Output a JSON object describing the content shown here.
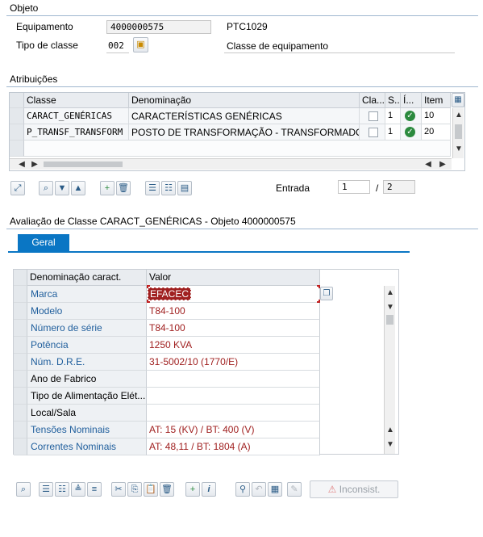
{
  "objeto": {
    "title": "Objeto",
    "equipamento_label": "Equipamento",
    "equipamento_value": "4000000575",
    "equipamento_desc": "PTC1029",
    "tipo_label": "Tipo de classe",
    "tipo_value": "002",
    "tipo_desc": "Classe de equipamento"
  },
  "atribuicoes": {
    "title": "Atribuições",
    "columns": [
      "Classe",
      "Denominação",
      "Cla...",
      "S...",
      "Í...",
      "Item"
    ],
    "rows": [
      {
        "classe": "CARACT_GENÉRICAS",
        "denominacao": "CARACTERÍSTICAS GENÉRICAS",
        "s": "1",
        "item": "10"
      },
      {
        "classe": "P_TRANSF_TRANSFORM",
        "denominacao": "POSTO DE TRANSFORMAÇÃO  - TRANSFORMADOR",
        "s": "1",
        "item": "20"
      }
    ],
    "entrada_label": "Entrada",
    "entrada_value": "1",
    "entrada_sep": "/",
    "entrada_total": "2"
  },
  "avaliacao": {
    "title": "Avaliação de Classe CARACT_GENÉRICAS - Objeto 4000000575",
    "tab_label": "Geral",
    "columns": [
      "Denominação caract.",
      "Valor"
    ],
    "rows": [
      {
        "name": "Marca",
        "value": "EFACEC",
        "link": true
      },
      {
        "name": "Modelo",
        "value": "T84-100",
        "link": true
      },
      {
        "name": "Número de série",
        "value": "T84-100",
        "link": true
      },
      {
        "name": "Potência",
        "value": "1250 KVA",
        "link": true
      },
      {
        "name": "Núm. D.R.E.",
        "value": "31-5002/10 (1770/E)",
        "link": true
      },
      {
        "name": "Ano de Fabrico",
        "value": "",
        "link": false
      },
      {
        "name": "Tipo de Alimentação Elét...",
        "value": "",
        "link": false
      },
      {
        "name": "Local/Sala",
        "value": "",
        "link": false
      },
      {
        "name": "Tensões Nominais",
        "value": "AT: 15 (KV) / BT: 400 (V)",
        "link": true
      },
      {
        "name": "Correntes Nominais",
        "value": "AT: 48,11 / BT: 1804 (A)",
        "link": true
      }
    ],
    "inconsist_label": "Inconsist."
  },
  "colors": {
    "accent": "#0a76c4",
    "link": "#1f5e9c",
    "value": "#a02020",
    "ok_green": "#2b8a3e"
  }
}
